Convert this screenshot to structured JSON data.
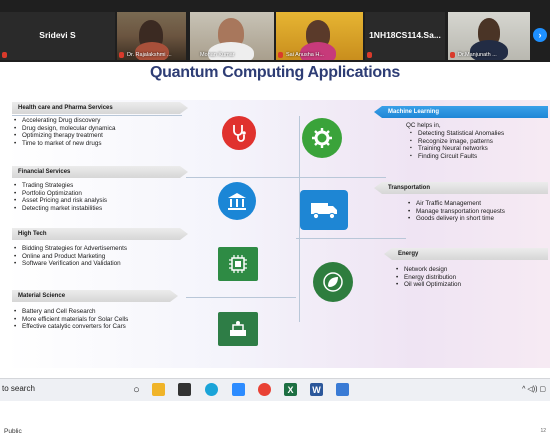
{
  "participants": [
    {
      "display": "Sridevi S",
      "has_video": false
    },
    {
      "display": "Dr. Rajalakshmi ...",
      "has_video": true
    },
    {
      "display": "Mohan Kumar",
      "has_video": true
    },
    {
      "display": "Sai Anusha H...",
      "has_video": true
    },
    {
      "display": "1NH18CS114.Sa...",
      "has_video": false
    },
    {
      "display": "Dr.Manjunath ...",
      "has_video": true
    }
  ],
  "slide": {
    "title": "Quantum Computing Applications",
    "sections_left": [
      {
        "header": "Health care and Pharma Services",
        "items": [
          "Accelerating Drug discovery",
          "Drug design, molecular dynamica",
          "Optimizing therapy treatment",
          "Time to market of new drugs"
        ],
        "icon": "stethoscope-icon"
      },
      {
        "header": "Financial Services",
        "items": [
          "Trading Strategies",
          "Portfolio Optimization",
          "Asset Pricing and risk analysis",
          "Detecting market instabilities"
        ],
        "icon": "bank-icon"
      },
      {
        "header": "High Tech",
        "items": [
          "Bidding Strategies for Advertisements",
          "Online and Product Marketing",
          "Software Verification and Validation"
        ],
        "icon": "chip-icon"
      },
      {
        "header": "Material Science",
        "items": [
          "Battery and Cell Research",
          "More efficient materials for Solar Cells",
          "Effective catalytic converters for Cars"
        ],
        "icon": "lab-icon"
      }
    ],
    "sections_right": [
      {
        "header": "Machine Learning",
        "intro": "QC helps in,",
        "items": [
          "Detecting Statistical Anomalies",
          "Recognize image, patterns",
          "Training Neural networks",
          "Finding Circuit Faults"
        ],
        "icon": "gear-icon"
      },
      {
        "header": "Transportation",
        "intro": "",
        "items": [
          "Air Traffic Management",
          "Manage transportation requests",
          "Goods delivery in short time"
        ],
        "icon": "truck-icon"
      },
      {
        "header": "Energy",
        "intro": "",
        "items": [
          "Network design",
          "Energy distribution",
          "Oil well Optimization"
        ],
        "icon": "leaf-icon"
      }
    ]
  },
  "footer": {
    "classification": "Public",
    "page": "12"
  },
  "taskbar": {
    "search": "to search"
  },
  "colors": {
    "title": "#2e3d75",
    "accent_blue": "#1f86d6",
    "dark_strip": "#1f1f1f"
  }
}
